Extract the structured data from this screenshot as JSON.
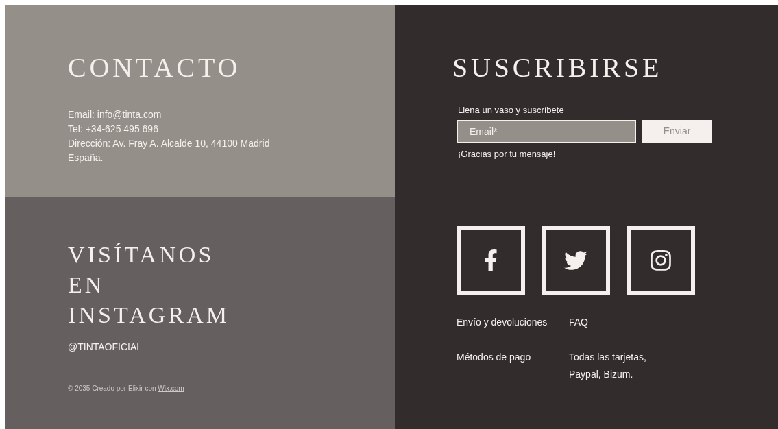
{
  "contact": {
    "title": "CONTACTO",
    "lines": [
      "Email: info@tinta.com",
      "Tel: +34-625 495 696",
      "Dirección: Av. Fray A. Alcalde 10, 44100 Madrid",
      "España."
    ]
  },
  "instagram": {
    "title_lines": [
      "VISÍTANOS",
      "EN",
      "INSTAGRAM"
    ],
    "handle": "@TINTAOFICIAL",
    "copyright": "© 2035 Creado por Elixir con",
    "copyright_link": "Wix.com"
  },
  "subscribe": {
    "title": "SUSCRIBIRSE",
    "prompt": "Llena un vaso y suscríbete",
    "email_field": {
      "placeholder": "Email*"
    },
    "submit": "Enviar",
    "confirmation": "¡Gracias por tu mensaje!"
  },
  "social": [
    {
      "kind": "facebook"
    },
    {
      "kind": "twitter"
    },
    {
      "kind": "instagram"
    }
  ],
  "info_rows": [
    {
      "label": "Envío y devoluciones",
      "value": "FAQ"
    },
    {
      "label": "Métodos de pago",
      "value": "Todas las tarjetas, Paypal, Bizum."
    }
  ]
}
